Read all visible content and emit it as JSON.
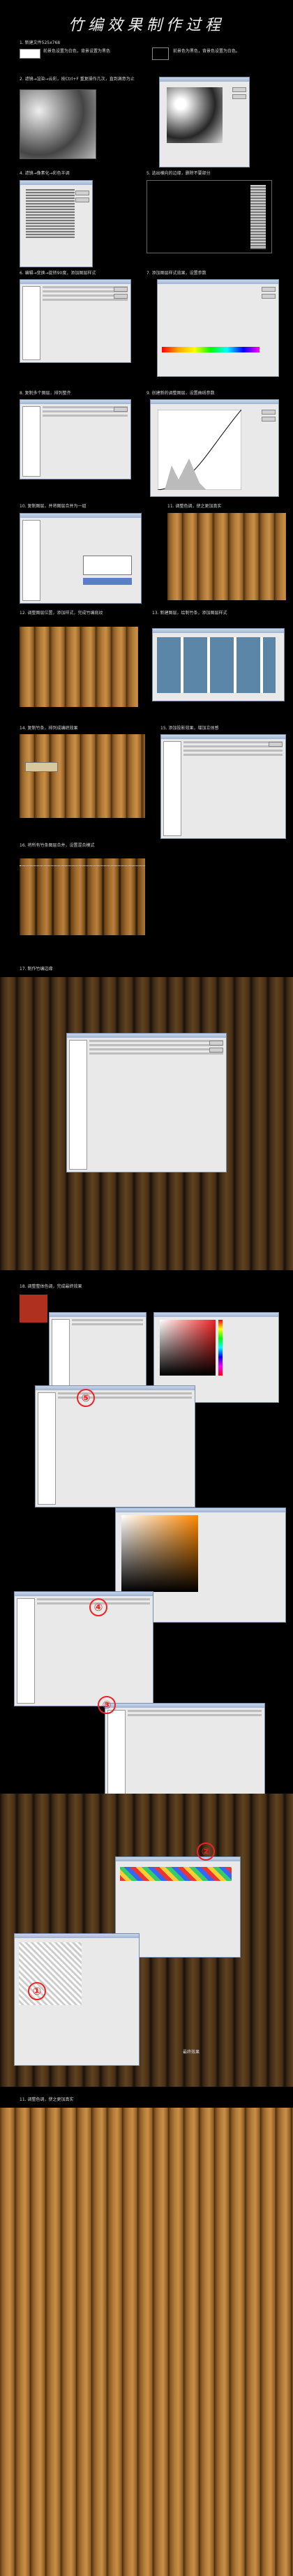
{
  "title": "竹编效果制作过程",
  "steps": {
    "s1": "1. 新建文件525x768",
    "s1b": "前景色设置为白色，背景设置为黑色",
    "s1c": "前景色为黑色，背景色设置为白色。",
    "s2": "2. 滤镜→渲染→云彩，按Ctrl+F 重复操作几次，直到满意为止",
    "s3": "3. 滤镜→渲染→分层云彩",
    "s4": "4. 滤镜→像素化→彩色半调",
    "s5": "5. 选出横向的边缘，删除不要部分",
    "s6": "6. 编辑→变换→旋转90度，添加图层样式",
    "s7": "7. 添加图层样式效果，设置参数",
    "s8": "8. 复制多个图层，排列整齐",
    "s9": "9. 创建新的调整图层，设置曲线参数",
    "s10": "10. 复制图层，并将图层合并为一组",
    "s11": "11. 调整色调，使之更加真实",
    "s12": "12. 调整图层位置，添加样式，完成竹编底纹",
    "s13": "13. 新建图层，绘制竹条，添加图层样式",
    "s14": "14. 复制竹条，排列成编织效果",
    "s15": "15. 添加投影效果，增加立体感",
    "s16": "16. 将所有竹条图层合并，设置混合模式",
    "s17": "17. 制作竹编边缘",
    "s18": "18. 调整整体色调，完成最终效果"
  },
  "markers": [
    "①",
    "②",
    "③",
    "④",
    "⑤"
  ],
  "final_caption": "最终效果"
}
